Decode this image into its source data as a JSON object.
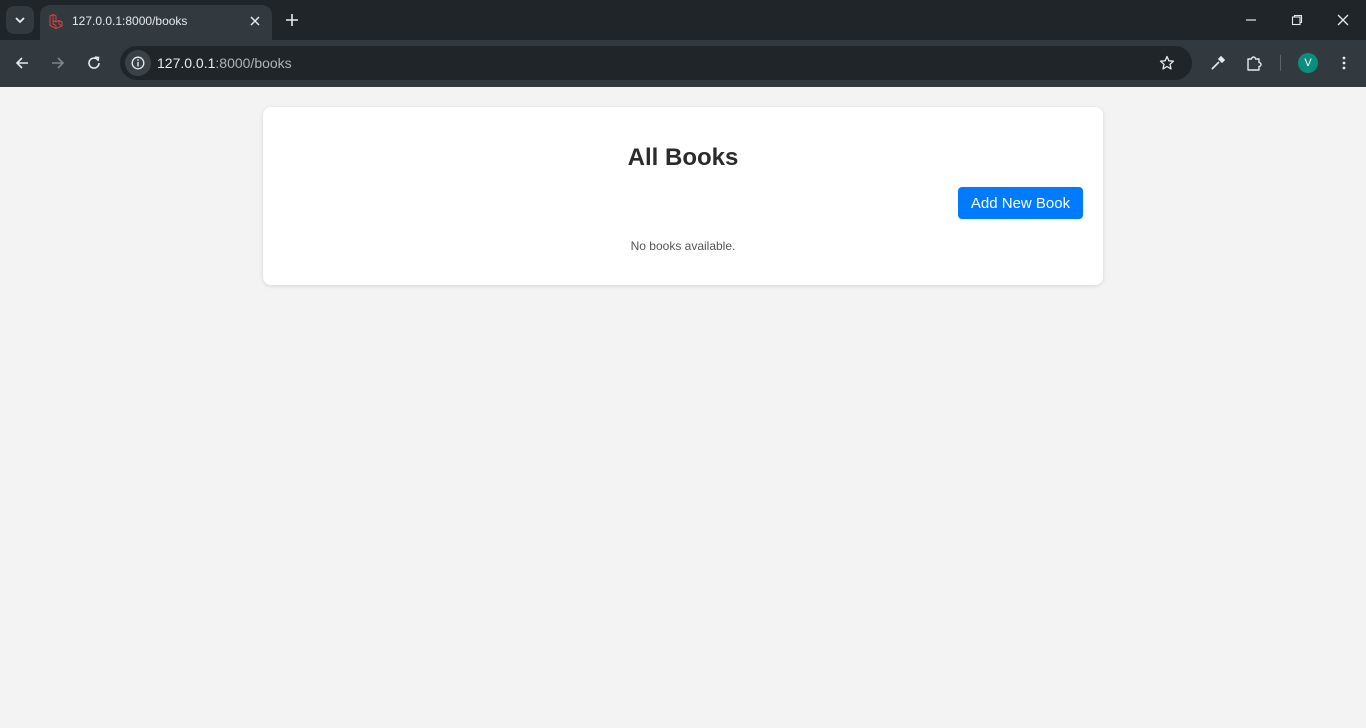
{
  "browser": {
    "tab": {
      "title": "127.0.0.1:8000/books",
      "favicon": "laravel-icon"
    },
    "address_bar": {
      "host": "127.0.0.1",
      "path": ":8000/books"
    },
    "profile_initial": "V",
    "colors": {
      "frame": "#1f2529",
      "toolbar": "#323a3f",
      "avatar": "#0b8f7c"
    }
  },
  "page": {
    "title": "All Books",
    "add_button_label": "Add New Book",
    "empty_message": "No books available.",
    "colors": {
      "background": "#f3f3f3",
      "card": "#ffffff",
      "primary": "#007bff"
    }
  }
}
